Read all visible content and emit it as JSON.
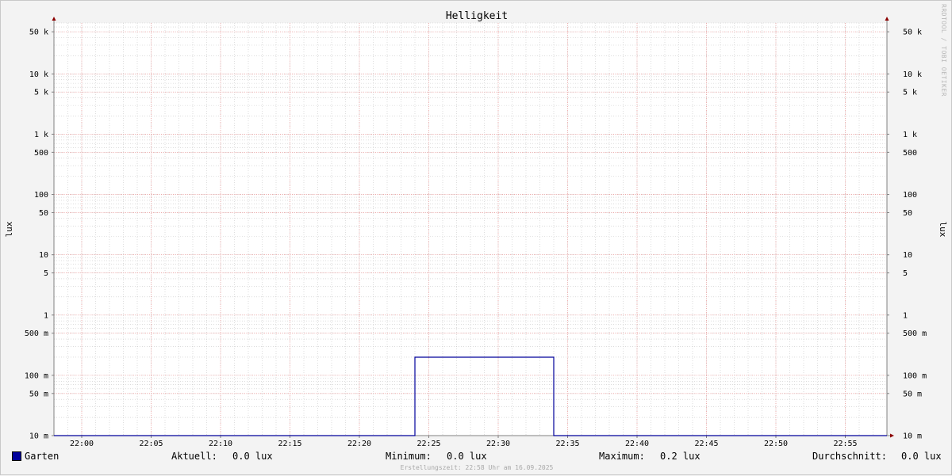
{
  "chart_data": {
    "type": "line",
    "title": "Helligkeit",
    "ylabel": "lux",
    "ylabel_right": "lux",
    "y_scale": "log",
    "ylim": [
      0.01,
      70000
    ],
    "x_tick_labels": [
      "22:00",
      "22:05",
      "22:10",
      "22:15",
      "22:20",
      "22:25",
      "22:30",
      "22:35",
      "22:40",
      "22:45",
      "22:50",
      "22:55"
    ],
    "y_tick_labels": [
      "10 m",
      "50 m",
      "100 m",
      "500 m",
      "1",
      "5",
      "10",
      "50",
      "100",
      "500",
      "1 k",
      "5 k",
      "10 k",
      "50 k"
    ],
    "y_tick_values": [
      0.01,
      0.05,
      0.1,
      0.5,
      1,
      5,
      10,
      50,
      100,
      500,
      1000,
      5000,
      10000,
      50000
    ],
    "xlim": [
      "21:58",
      "22:58"
    ],
    "grid": true,
    "series": [
      {
        "name": "Garten",
        "color": "#00009b",
        "x": [
          "21:58",
          "22:24",
          "22:24",
          "22:34",
          "22:34",
          "22:58"
        ],
        "values": [
          0.01,
          0.01,
          0.2,
          0.2,
          0.01,
          0.01
        ]
      }
    ]
  },
  "legend": {
    "series_name": "Garten",
    "aktuell_label": "Aktuell:",
    "aktuell_value": "0.0 lux",
    "minimum_label": "Minimum:",
    "minimum_value": "0.0 lux",
    "maximum_label": "Maximum:",
    "maximum_value": "0.2 lux",
    "durchschnitt_label": "Durchschnitt:",
    "durchschnitt_value": "0.0 lux"
  },
  "footer": "Erstellungszeit: 22:58 Uhr am 16.09.2025",
  "watermark": "RRDTOOL / TOBI OETIKER",
  "colors": {
    "background": "#f3f3f3",
    "plot_background": "#ffffff",
    "major_grid": "#f0a0a0",
    "minor_grid": "#c8c8c8",
    "axis": "#808080",
    "arrow": "#8b0000",
    "series": "#00009b"
  }
}
